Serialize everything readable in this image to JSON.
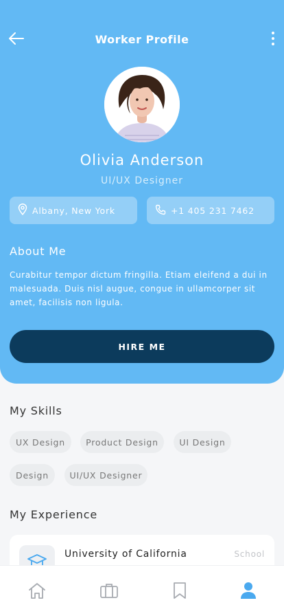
{
  "header": {
    "title": "Worker Profile",
    "back_icon": "arrow-left-icon",
    "more_icon": "more-vertical-icon"
  },
  "profile": {
    "name": "Olivia Anderson",
    "role": "UI/UX Designer",
    "location": "Albany, New York",
    "phone": "+1 405 231 7462"
  },
  "about": {
    "title": "About Me",
    "text": "Curabitur tempor dictum fringilla. Etiam eleifend a dui in malesuada. Duis nisl augue, congue in ullamcorper sit amet, facilisis non ligula."
  },
  "hire_label": "HIRE ME",
  "skills": {
    "title": "My Skills",
    "items": [
      "UX Design",
      "Product Design",
      "UI Design",
      "Design",
      "UI/UX Designer"
    ]
  },
  "experience": {
    "title": "My Experience",
    "items": [
      {
        "name": "University of California",
        "type": "School",
        "icon": "graduation-cap-icon"
      }
    ]
  },
  "tabs": [
    {
      "name": "home",
      "icon": "home-icon",
      "active": false
    },
    {
      "name": "jobs",
      "icon": "briefcase-icon",
      "active": false
    },
    {
      "name": "saved",
      "icon": "bookmark-icon",
      "active": false
    },
    {
      "name": "profile",
      "icon": "user-icon",
      "active": true
    }
  ],
  "colors": {
    "primary": "#62b9f4",
    "button": "#0c3b5c",
    "background": "#f5f6f8",
    "chip": "#ebedef",
    "tab_active": "#4aa9ef",
    "tab_inactive": "#a7abb1"
  }
}
